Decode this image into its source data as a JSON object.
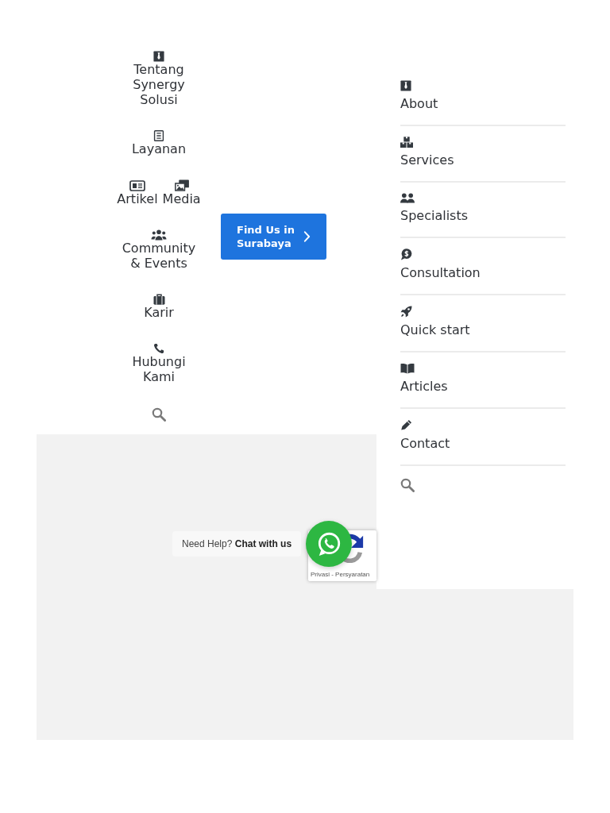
{
  "left_nav": {
    "rows": [
      {
        "items": [
          {
            "label": "Tentang Synergy Solusi"
          }
        ]
      },
      {
        "items": [
          {
            "label": "Layanan"
          }
        ]
      },
      {
        "items": [
          {
            "label": "Artikel"
          },
          {
            "label": "Media"
          }
        ]
      },
      {
        "items": [
          {
            "label": "Community & Events"
          }
        ]
      },
      {
        "items": [
          {
            "label": "Karir"
          }
        ]
      },
      {
        "items": [
          {
            "label": "Hubungi Kami"
          }
        ]
      }
    ]
  },
  "find_us_button": {
    "label": "Find Us in Surabaya"
  },
  "side_menu": {
    "items": [
      {
        "label": "About"
      },
      {
        "label": "Services"
      },
      {
        "label": "Specialists"
      },
      {
        "label": "Consultation"
      },
      {
        "label": "Quick start"
      },
      {
        "label": "Articles"
      },
      {
        "label": "Contact"
      }
    ]
  },
  "chat_widget": {
    "prompt": "Need Help? **Chat with us**"
  },
  "recaptcha_badge": {
    "links": "Privasi - Persyaratan"
  }
}
